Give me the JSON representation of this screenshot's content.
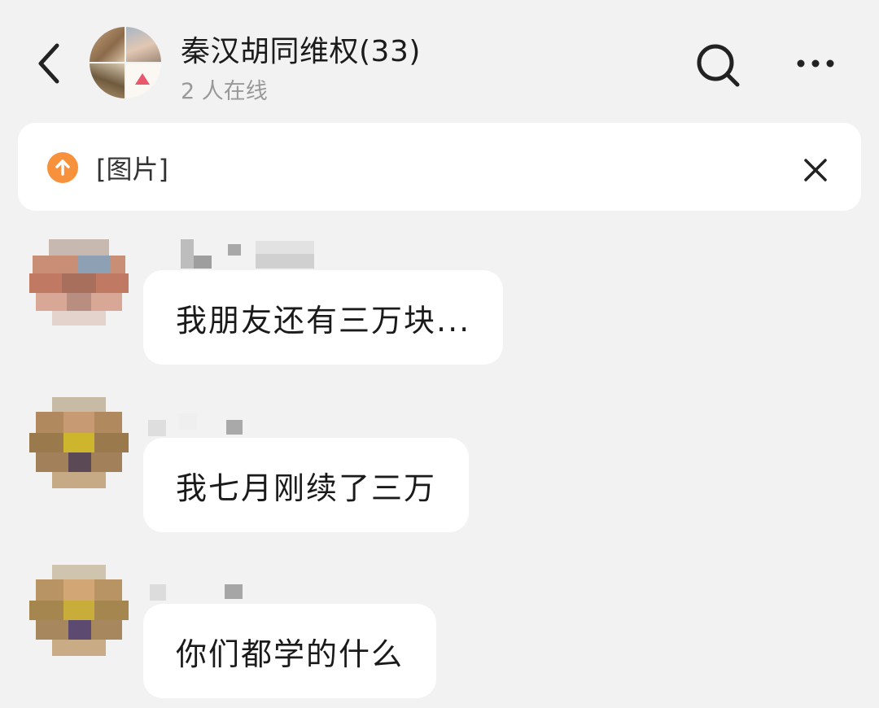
{
  "header": {
    "title": "秦汉胡同维权(33)",
    "subtitle": "2 人在线"
  },
  "pinned": {
    "text": "[图片]"
  },
  "messages": [
    {
      "text": "我朋友还有三万块..."
    },
    {
      "text": "我七月刚续了三万"
    },
    {
      "text": "你们都学的什么"
    }
  ]
}
